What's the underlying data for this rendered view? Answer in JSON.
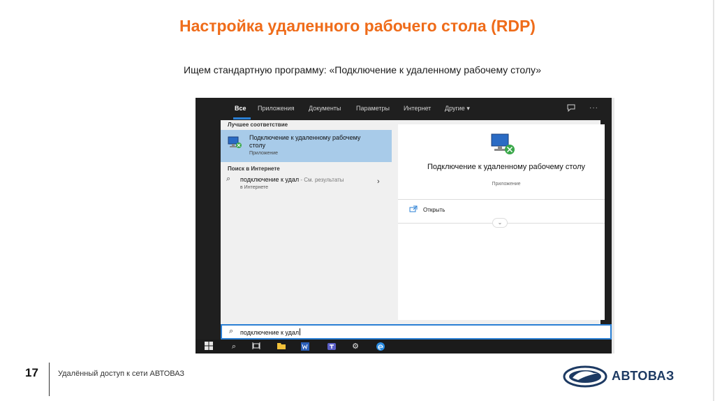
{
  "slide": {
    "title": "Настройка удаленного рабочего стола (RDP)",
    "subtitle": "Ищем стандартную программу: «Подключение к удаленному рабочему столу»"
  },
  "search_ui": {
    "tabs": [
      {
        "label": "Все",
        "active": true
      },
      {
        "label": "Приложения",
        "active": false
      },
      {
        "label": "Документы",
        "active": false
      },
      {
        "label": "Параметры",
        "active": false
      },
      {
        "label": "Интернет",
        "active": false
      },
      {
        "label": "Другие",
        "active": false
      }
    ],
    "tab_icons": [
      "feedback-icon",
      "more-options-icon"
    ],
    "best_match": {
      "header": "Лучшее соответствие",
      "title": "Подключение к удаленному рабочему столу",
      "subtitle": "Приложение"
    },
    "web": {
      "header": "Поиск в Интернете",
      "query": "подключение к удал",
      "hint": " - См. результаты",
      "subtitle": "в Интернете"
    },
    "detail": {
      "app_name": "Подключение к удаленному рабочему столу",
      "app_type": "Приложение",
      "open_label": "Открыть"
    },
    "search_box": {
      "value": "подключение к удал"
    },
    "taskbar_icons": [
      "windows-start-icon",
      "search-icon",
      "task-view-icon",
      "file-explorer-icon",
      "word-icon",
      "teams-icon",
      "settings-icon",
      "edge-icon"
    ]
  },
  "footer": {
    "page_number": "17",
    "text": "Удалённый доступ к сети АВТОВАЗ",
    "logo_text": "АВТОВАЗ"
  },
  "colors": {
    "title": "#ef6c1a",
    "accent": "#2a7fd4",
    "selected": "#a8cbe9",
    "logo": "#1d3a63"
  }
}
